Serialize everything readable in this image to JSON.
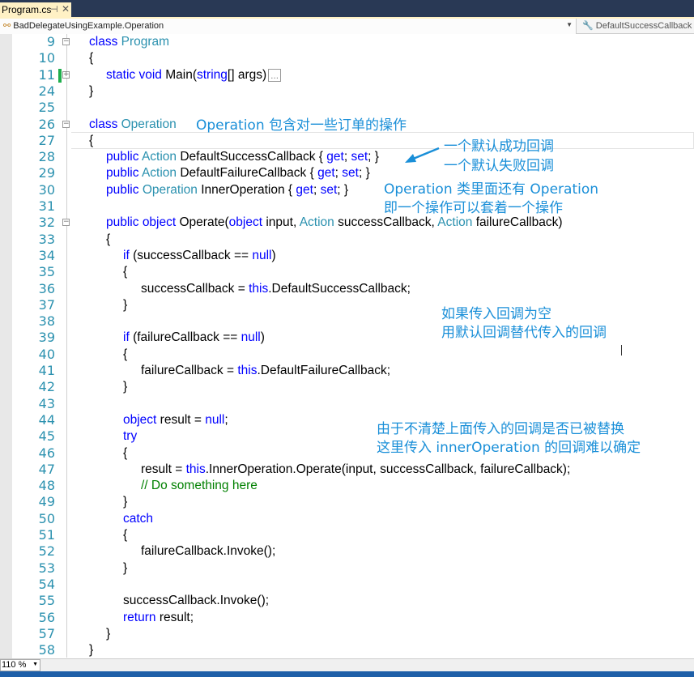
{
  "tab": {
    "title": "Program.cs",
    "pin_icon": "pin-icon",
    "close_icon": "close-icon"
  },
  "nav": {
    "type_selector": "BadDelegateUsingExample.Operation",
    "member_selector": "DefaultSuccessCallback"
  },
  "colors": {
    "keyword": "#0000ff",
    "type": "#2b91af",
    "comment": "#008000",
    "line_number": "#2b91af",
    "annotation": "#1a8fd8",
    "change_bar": "#1fae4c"
  },
  "code_lines": [
    {
      "n": "9",
      "indent": 1,
      "fold": "minus",
      "tokens": [
        [
          "class ",
          "kw"
        ],
        [
          "Program",
          "ty"
        ]
      ]
    },
    {
      "n": "10",
      "indent": 1,
      "tokens": [
        [
          "{",
          ""
        ]
      ]
    },
    {
      "n": "11",
      "indent": 2,
      "fold": "plus",
      "changed": true,
      "tokens": [
        [
          "static ",
          "kw"
        ],
        [
          "void ",
          "kw"
        ],
        [
          "Main(",
          ""
        ],
        [
          "string",
          "kw"
        ],
        [
          "[] args)",
          ""
        ]
      ],
      "collapsed": "..."
    },
    {
      "n": "24",
      "indent": 1,
      "tokens": [
        [
          "}",
          ""
        ]
      ]
    },
    {
      "n": "25",
      "indent": 0,
      "tokens": []
    },
    {
      "n": "26",
      "indent": 1,
      "fold": "minus",
      "tokens": [
        [
          "class ",
          "kw"
        ],
        [
          "Operation",
          "ty"
        ]
      ]
    },
    {
      "n": "27",
      "indent": 1,
      "tokens": [
        [
          "{",
          ""
        ]
      ]
    },
    {
      "n": "28",
      "indent": 2,
      "tokens": [
        [
          "public ",
          "kw"
        ],
        [
          "Action ",
          "ty"
        ],
        [
          "DefaultSuccessCallback { ",
          ""
        ],
        [
          "get",
          "kw"
        ],
        [
          "; ",
          ""
        ],
        [
          "set",
          "kw"
        ],
        [
          "; }",
          ""
        ]
      ]
    },
    {
      "n": "29",
      "indent": 2,
      "tokens": [
        [
          "public ",
          "kw"
        ],
        [
          "Action ",
          "ty"
        ],
        [
          "DefaultFailureCallback { ",
          ""
        ],
        [
          "get",
          "kw"
        ],
        [
          "; ",
          ""
        ],
        [
          "set",
          "kw"
        ],
        [
          "; }",
          ""
        ]
      ]
    },
    {
      "n": "30",
      "indent": 2,
      "tokens": [
        [
          "public ",
          "kw"
        ],
        [
          "Operation ",
          "ty"
        ],
        [
          "InnerOperation { ",
          ""
        ],
        [
          "get",
          "kw"
        ],
        [
          "; ",
          ""
        ],
        [
          "set",
          "kw"
        ],
        [
          "; }",
          ""
        ]
      ]
    },
    {
      "n": "31",
      "indent": 0,
      "tokens": []
    },
    {
      "n": "32",
      "indent": 2,
      "fold": "minus",
      "tokens": [
        [
          "public ",
          "kw"
        ],
        [
          "object ",
          "kw"
        ],
        [
          "Operate(",
          ""
        ],
        [
          "object ",
          "kw"
        ],
        [
          "input, ",
          ""
        ],
        [
          "Action ",
          "ty"
        ],
        [
          "successCallback, ",
          ""
        ],
        [
          "Action ",
          "ty"
        ],
        [
          "failureCallback)",
          ""
        ]
      ]
    },
    {
      "n": "33",
      "indent": 2,
      "tokens": [
        [
          "{",
          ""
        ]
      ]
    },
    {
      "n": "34",
      "indent": 3,
      "tokens": [
        [
          "if ",
          "kw"
        ],
        [
          "(successCallback == ",
          ""
        ],
        [
          "null",
          "kw"
        ],
        [
          ")",
          ""
        ]
      ]
    },
    {
      "n": "35",
      "indent": 3,
      "tokens": [
        [
          "{",
          ""
        ]
      ]
    },
    {
      "n": "36",
      "indent": 4,
      "tokens": [
        [
          "successCallback = ",
          ""
        ],
        [
          "this",
          "kw"
        ],
        [
          ".DefaultSuccessCallback;",
          ""
        ]
      ]
    },
    {
      "n": "37",
      "indent": 3,
      "tokens": [
        [
          "}",
          ""
        ]
      ]
    },
    {
      "n": "38",
      "indent": 0,
      "tokens": []
    },
    {
      "n": "39",
      "indent": 3,
      "tokens": [
        [
          "if ",
          "kw"
        ],
        [
          "(failureCallback == ",
          ""
        ],
        [
          "null",
          "kw"
        ],
        [
          ")",
          ""
        ]
      ]
    },
    {
      "n": "40",
      "indent": 3,
      "tokens": [
        [
          "{",
          ""
        ]
      ]
    },
    {
      "n": "41",
      "indent": 4,
      "tokens": [
        [
          "failureCallback = ",
          ""
        ],
        [
          "this",
          "kw"
        ],
        [
          ".DefaultFailureCallback;",
          ""
        ]
      ]
    },
    {
      "n": "42",
      "indent": 3,
      "tokens": [
        [
          "}",
          ""
        ]
      ]
    },
    {
      "n": "43",
      "indent": 0,
      "tokens": []
    },
    {
      "n": "44",
      "indent": 3,
      "tokens": [
        [
          "object ",
          "kw"
        ],
        [
          "result = ",
          ""
        ],
        [
          "null",
          "kw"
        ],
        [
          ";",
          ""
        ]
      ]
    },
    {
      "n": "45",
      "indent": 3,
      "tokens": [
        [
          "try",
          "kw"
        ]
      ]
    },
    {
      "n": "46",
      "indent": 3,
      "tokens": [
        [
          "{",
          ""
        ]
      ]
    },
    {
      "n": "47",
      "indent": 4,
      "tokens": [
        [
          "result = ",
          ""
        ],
        [
          "this",
          "kw"
        ],
        [
          ".InnerOperation.Operate(input, successCallback, failureCallback);",
          ""
        ]
      ]
    },
    {
      "n": "48",
      "indent": 4,
      "tokens": [
        [
          "// Do something here",
          "cm"
        ]
      ]
    },
    {
      "n": "49",
      "indent": 3,
      "tokens": [
        [
          "}",
          ""
        ]
      ]
    },
    {
      "n": "50",
      "indent": 3,
      "tokens": [
        [
          "catch",
          "kw"
        ]
      ]
    },
    {
      "n": "51",
      "indent": 3,
      "tokens": [
        [
          "{",
          ""
        ]
      ]
    },
    {
      "n": "52",
      "indent": 4,
      "tokens": [
        [
          "failureCallback.Invoke();",
          ""
        ]
      ]
    },
    {
      "n": "53",
      "indent": 3,
      "tokens": [
        [
          "}",
          ""
        ]
      ]
    },
    {
      "n": "54",
      "indent": 0,
      "tokens": []
    },
    {
      "n": "55",
      "indent": 3,
      "tokens": [
        [
          "successCallback.Invoke();",
          ""
        ]
      ]
    },
    {
      "n": "56",
      "indent": 3,
      "tokens": [
        [
          "return ",
          "kw"
        ],
        [
          "result;",
          ""
        ]
      ]
    },
    {
      "n": "57",
      "indent": 2,
      "tokens": [
        [
          "}",
          ""
        ]
      ]
    },
    {
      "n": "58",
      "indent": 1,
      "tokens": [
        [
          "}",
          ""
        ]
      ]
    }
  ],
  "annotations": {
    "a1": "Operation 包含对一些订单的操作",
    "a2_line1": "一个默认成功回调",
    "a2_line2": "一个默认失败回调",
    "a3_line1": "Operation 类里面还有 Operation",
    "a3_line2": "即一个操作可以套着一个操作",
    "a4_line1": "如果传入回调为空",
    "a4_line2": "用默认回调替代传入的回调",
    "a5_line1": "由于不清楚上面传入的回调是否已被替换",
    "a5_line2": "这里传入 innerOperation 的回调难以确定"
  },
  "status": {
    "zoom": "110 %"
  }
}
